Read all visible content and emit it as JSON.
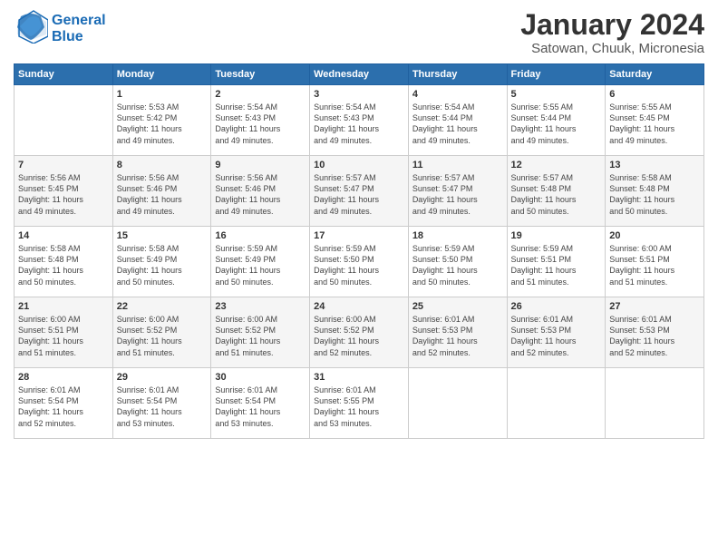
{
  "header": {
    "logo_line1": "General",
    "logo_line2": "Blue",
    "month_title": "January 2024",
    "subtitle": "Satowan, Chuuk, Micronesia"
  },
  "weekdays": [
    "Sunday",
    "Monday",
    "Tuesday",
    "Wednesday",
    "Thursday",
    "Friday",
    "Saturday"
  ],
  "weeks": [
    [
      {
        "day": "",
        "info": ""
      },
      {
        "day": "1",
        "info": "Sunrise: 5:53 AM\nSunset: 5:42 PM\nDaylight: 11 hours\nand 49 minutes."
      },
      {
        "day": "2",
        "info": "Sunrise: 5:54 AM\nSunset: 5:43 PM\nDaylight: 11 hours\nand 49 minutes."
      },
      {
        "day": "3",
        "info": "Sunrise: 5:54 AM\nSunset: 5:43 PM\nDaylight: 11 hours\nand 49 minutes."
      },
      {
        "day": "4",
        "info": "Sunrise: 5:54 AM\nSunset: 5:44 PM\nDaylight: 11 hours\nand 49 minutes."
      },
      {
        "day": "5",
        "info": "Sunrise: 5:55 AM\nSunset: 5:44 PM\nDaylight: 11 hours\nand 49 minutes."
      },
      {
        "day": "6",
        "info": "Sunrise: 5:55 AM\nSunset: 5:45 PM\nDaylight: 11 hours\nand 49 minutes."
      }
    ],
    [
      {
        "day": "7",
        "info": "Sunrise: 5:56 AM\nSunset: 5:45 PM\nDaylight: 11 hours\nand 49 minutes."
      },
      {
        "day": "8",
        "info": "Sunrise: 5:56 AM\nSunset: 5:46 PM\nDaylight: 11 hours\nand 49 minutes."
      },
      {
        "day": "9",
        "info": "Sunrise: 5:56 AM\nSunset: 5:46 PM\nDaylight: 11 hours\nand 49 minutes."
      },
      {
        "day": "10",
        "info": "Sunrise: 5:57 AM\nSunset: 5:47 PM\nDaylight: 11 hours\nand 49 minutes."
      },
      {
        "day": "11",
        "info": "Sunrise: 5:57 AM\nSunset: 5:47 PM\nDaylight: 11 hours\nand 49 minutes."
      },
      {
        "day": "12",
        "info": "Sunrise: 5:57 AM\nSunset: 5:48 PM\nDaylight: 11 hours\nand 50 minutes."
      },
      {
        "day": "13",
        "info": "Sunrise: 5:58 AM\nSunset: 5:48 PM\nDaylight: 11 hours\nand 50 minutes."
      }
    ],
    [
      {
        "day": "14",
        "info": "Sunrise: 5:58 AM\nSunset: 5:48 PM\nDaylight: 11 hours\nand 50 minutes."
      },
      {
        "day": "15",
        "info": "Sunrise: 5:58 AM\nSunset: 5:49 PM\nDaylight: 11 hours\nand 50 minutes."
      },
      {
        "day": "16",
        "info": "Sunrise: 5:59 AM\nSunset: 5:49 PM\nDaylight: 11 hours\nand 50 minutes."
      },
      {
        "day": "17",
        "info": "Sunrise: 5:59 AM\nSunset: 5:50 PM\nDaylight: 11 hours\nand 50 minutes."
      },
      {
        "day": "18",
        "info": "Sunrise: 5:59 AM\nSunset: 5:50 PM\nDaylight: 11 hours\nand 50 minutes."
      },
      {
        "day": "19",
        "info": "Sunrise: 5:59 AM\nSunset: 5:51 PM\nDaylight: 11 hours\nand 51 minutes."
      },
      {
        "day": "20",
        "info": "Sunrise: 6:00 AM\nSunset: 5:51 PM\nDaylight: 11 hours\nand 51 minutes."
      }
    ],
    [
      {
        "day": "21",
        "info": "Sunrise: 6:00 AM\nSunset: 5:51 PM\nDaylight: 11 hours\nand 51 minutes."
      },
      {
        "day": "22",
        "info": "Sunrise: 6:00 AM\nSunset: 5:52 PM\nDaylight: 11 hours\nand 51 minutes."
      },
      {
        "day": "23",
        "info": "Sunrise: 6:00 AM\nSunset: 5:52 PM\nDaylight: 11 hours\nand 51 minutes."
      },
      {
        "day": "24",
        "info": "Sunrise: 6:00 AM\nSunset: 5:52 PM\nDaylight: 11 hours\nand 52 minutes."
      },
      {
        "day": "25",
        "info": "Sunrise: 6:01 AM\nSunset: 5:53 PM\nDaylight: 11 hours\nand 52 minutes."
      },
      {
        "day": "26",
        "info": "Sunrise: 6:01 AM\nSunset: 5:53 PM\nDaylight: 11 hours\nand 52 minutes."
      },
      {
        "day": "27",
        "info": "Sunrise: 6:01 AM\nSunset: 5:53 PM\nDaylight: 11 hours\nand 52 minutes."
      }
    ],
    [
      {
        "day": "28",
        "info": "Sunrise: 6:01 AM\nSunset: 5:54 PM\nDaylight: 11 hours\nand 52 minutes."
      },
      {
        "day": "29",
        "info": "Sunrise: 6:01 AM\nSunset: 5:54 PM\nDaylight: 11 hours\nand 53 minutes."
      },
      {
        "day": "30",
        "info": "Sunrise: 6:01 AM\nSunset: 5:54 PM\nDaylight: 11 hours\nand 53 minutes."
      },
      {
        "day": "31",
        "info": "Sunrise: 6:01 AM\nSunset: 5:55 PM\nDaylight: 11 hours\nand 53 minutes."
      },
      {
        "day": "",
        "info": ""
      },
      {
        "day": "",
        "info": ""
      },
      {
        "day": "",
        "info": ""
      }
    ]
  ]
}
